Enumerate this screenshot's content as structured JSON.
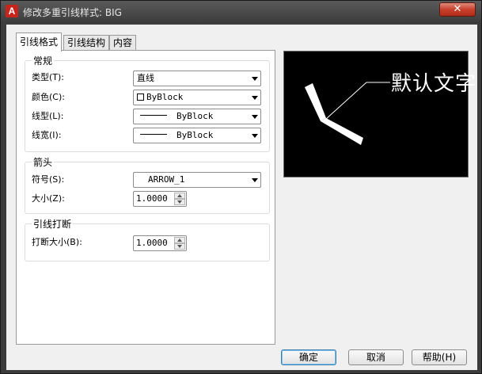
{
  "window": {
    "title": "修改多重引线样式: BIG",
    "app_icon": "autocad-a-icon",
    "close_glyph": "✕"
  },
  "tabs": [
    {
      "label": "引线格式",
      "active": true
    },
    {
      "label": "引线结构",
      "active": false
    },
    {
      "label": "内容",
      "active": false
    }
  ],
  "general": {
    "title": "常规",
    "type_label": "类型(T):",
    "type_value": "直线",
    "color_label": "颜色(C):",
    "color_value": "ByBlock",
    "linetype_label": "线型(L):",
    "linetype_value": "ByBlock",
    "lineweight_label": "线宽(I):",
    "lineweight_value": "ByBlock"
  },
  "arrowhead": {
    "title": "箭头",
    "symbol_label": "符号(S):",
    "symbol_value": "ARROW_1",
    "size_label": "大小(Z):",
    "size_value": "1.0000"
  },
  "leader_break": {
    "title": "引线打断",
    "break_size_label": "打断大小(B):",
    "break_size_value": "1.0000"
  },
  "preview": {
    "text": "默认文字"
  },
  "buttons": {
    "ok": "确定",
    "cancel": "取消",
    "help": "帮助(H)"
  },
  "colors": {
    "title_bar": "#4a4a4a",
    "preview_bg": "#000000",
    "close_button": "#c8402c"
  }
}
